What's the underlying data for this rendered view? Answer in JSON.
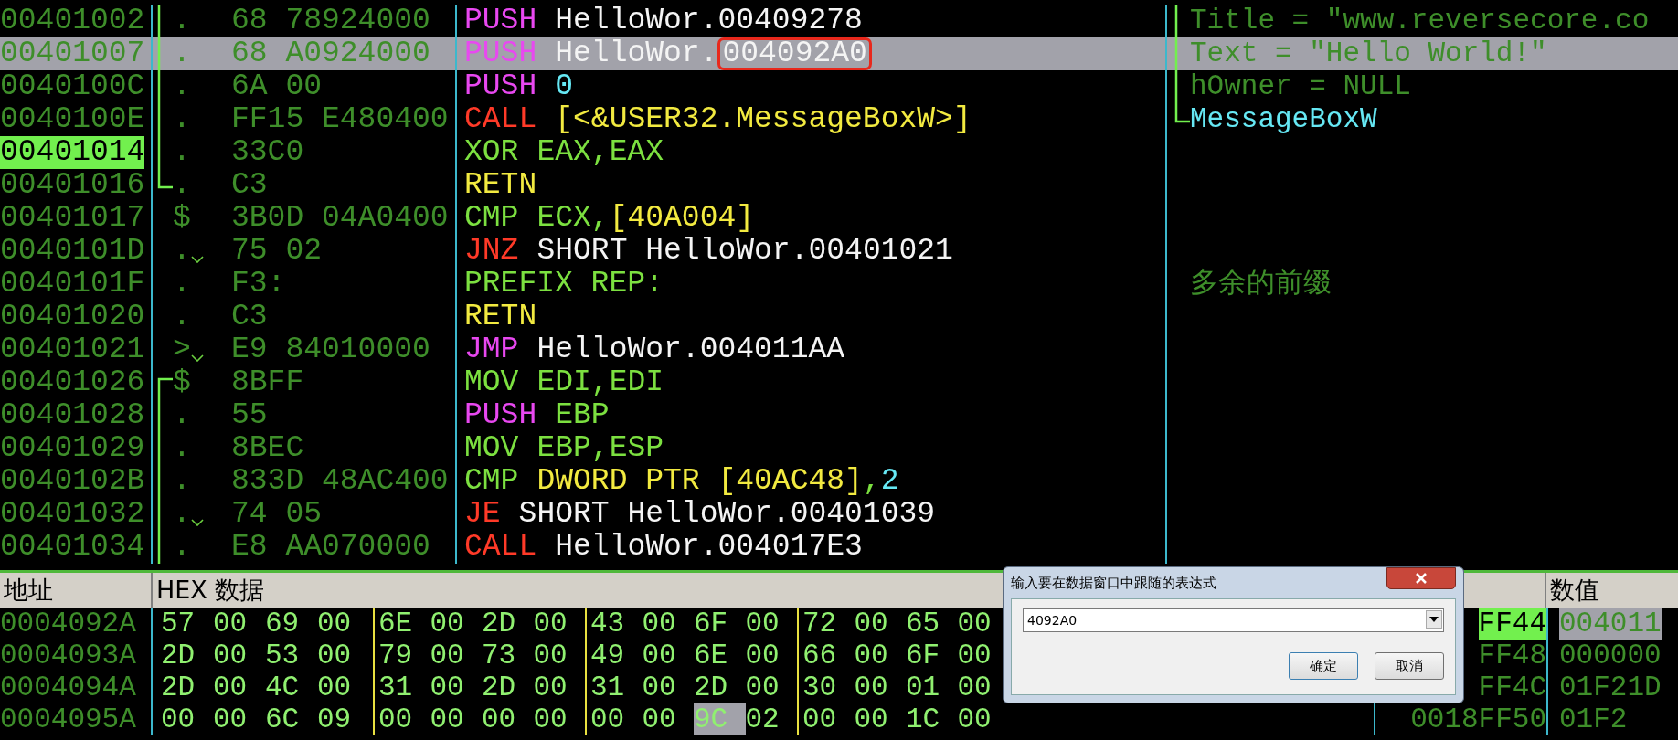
{
  "code_rows": [
    {
      "address": "00401002",
      "current": false,
      "selected": false,
      "bracket": {
        "kind": "mid"
      },
      "marker": ".",
      "jump_mark": false,
      "bytes": "68 78924000",
      "instruction": {
        "mnemonic": "PUSH",
        "kind": "push",
        "operands": [
          {
            "t": "HelloWor.00409278",
            "kind": "label"
          }
        ]
      },
      "comment": {
        "text": "Title = ″www.reversecore.co",
        "kind": "arg",
        "bracket": {
          "kind": "mid"
        }
      }
    },
    {
      "address": "00401007",
      "current": false,
      "selected": true,
      "bracket": {
        "kind": "mid"
      },
      "marker": ".",
      "jump_mark": false,
      "bytes": "68 A0924000",
      "instruction": {
        "mnemonic": "PUSH",
        "kind": "push",
        "operands": [
          {
            "t": "HelloWor.",
            "kind": "label"
          },
          {
            "t": "004092A0",
            "kind": "annotated"
          }
        ]
      },
      "comment": {
        "text": "Text = ″Hello World!″",
        "kind": "arg",
        "bracket": {
          "kind": "mid"
        }
      }
    },
    {
      "address": "0040100C",
      "current": false,
      "selected": false,
      "bracket": {
        "kind": "mid"
      },
      "marker": ".",
      "jump_mark": false,
      "bytes": "6A 00",
      "instruction": {
        "mnemonic": "PUSH",
        "kind": "push",
        "operands": [
          {
            "t": "0",
            "kind": "const"
          }
        ]
      },
      "comment": {
        "text": "hOwner = NULL",
        "kind": "arg",
        "bracket": {
          "kind": "mid"
        }
      }
    },
    {
      "address": "0040100E",
      "current": false,
      "selected": false,
      "bracket": {
        "kind": "mid"
      },
      "marker": ".",
      "jump_mark": false,
      "bytes": "FF15 E480400",
      "instruction": {
        "mnemonic": "CALL",
        "kind": "call",
        "operands": [
          {
            "t": "[<&USER32.MessageBoxW>]",
            "kind": "mem"
          }
        ]
      },
      "comment": {
        "text": "MessageBoxW",
        "kind": "api",
        "bracket": {
          "kind": "end"
        }
      }
    },
    {
      "address": "00401014",
      "current": true,
      "selected": false,
      "bracket": {
        "kind": "mid"
      },
      "marker": ".",
      "jump_mark": false,
      "bytes": "33C0",
      "instruction": {
        "mnemonic": "XOR",
        "kind": "plain",
        "operands": [
          {
            "t": "EAX,EAX",
            "kind": "reg"
          }
        ]
      }
    },
    {
      "address": "00401016",
      "current": false,
      "selected": false,
      "bracket": {
        "kind": "end"
      },
      "marker": ".",
      "jump_mark": false,
      "bytes": "C3",
      "instruction": {
        "mnemonic": "RETN",
        "kind": "ret"
      }
    },
    {
      "address": "00401017",
      "current": false,
      "selected": false,
      "marker": "$",
      "jump_mark": false,
      "bytes": "3B0D 04A0400",
      "instruction": {
        "mnemonic": "CMP",
        "kind": "plain",
        "operands": [
          {
            "t": "ECX,",
            "kind": "reg"
          },
          {
            "t": "[40A004]",
            "kind": "mem"
          }
        ]
      }
    },
    {
      "address": "0040101D",
      "current": false,
      "selected": false,
      "marker": ".",
      "jump_mark": true,
      "bytes": "75 02",
      "instruction": {
        "mnemonic": "JNZ",
        "kind": "jcc",
        "operands": [
          {
            "t": "SHORT HelloWor.00401021",
            "kind": "label"
          }
        ]
      }
    },
    {
      "address": "0040101F",
      "current": false,
      "selected": false,
      "marker": ".",
      "jump_mark": false,
      "bytes": "F3:",
      "instruction": {
        "mnemonic": "PREFIX REP:",
        "kind": "plain"
      },
      "comment": {
        "text": "多余的前缀",
        "kind": "arg"
      }
    },
    {
      "address": "00401020",
      "current": false,
      "selected": false,
      "marker": ".",
      "jump_mark": false,
      "bytes": "C3",
      "instruction": {
        "mnemonic": "RETN",
        "kind": "ret"
      }
    },
    {
      "address": "00401021",
      "current": false,
      "selected": false,
      "marker": ">",
      "jump_mark": true,
      "bytes": "E9 84010000",
      "instruction": {
        "mnemonic": "JMP",
        "kind": "push",
        "operands": [
          {
            "t": "HelloWor.004011AA",
            "kind": "label"
          }
        ]
      }
    },
    {
      "address": "00401026",
      "current": false,
      "selected": false,
      "bracket": {
        "kind": "start"
      },
      "marker": "$",
      "jump_mark": false,
      "bytes": "8BFF",
      "instruction": {
        "mnemonic": "MOV",
        "kind": "plain",
        "operands": [
          {
            "t": "EDI,EDI",
            "kind": "reg"
          }
        ]
      }
    },
    {
      "address": "00401028",
      "current": false,
      "selected": false,
      "bracket": {
        "kind": "mid"
      },
      "marker": ".",
      "jump_mark": false,
      "bytes": "55",
      "instruction": {
        "mnemonic": "PUSH",
        "kind": "push",
        "operands": [
          {
            "t": "EBP",
            "kind": "reg"
          }
        ]
      }
    },
    {
      "address": "00401029",
      "current": false,
      "selected": false,
      "bracket": {
        "kind": "mid"
      },
      "marker": ".",
      "jump_mark": false,
      "bytes": "8BEC",
      "instruction": {
        "mnemonic": "MOV",
        "kind": "plain",
        "operands": [
          {
            "t": "EBP,ESP",
            "kind": "reg"
          }
        ]
      }
    },
    {
      "address": "0040102B",
      "current": false,
      "selected": false,
      "bracket": {
        "kind": "mid"
      },
      "marker": ".",
      "jump_mark": false,
      "bytes": "833D 48AC400",
      "instruction": {
        "mnemonic": "CMP",
        "kind": "plain",
        "operands": [
          {
            "t": "DWORD PTR [40AC48]",
            "kind": "mem"
          },
          {
            "t": ",",
            "kind": "reg"
          },
          {
            "t": "2",
            "kind": "const"
          }
        ]
      }
    },
    {
      "address": "00401032",
      "current": false,
      "selected": false,
      "bracket": {
        "kind": "mid"
      },
      "marker": ".",
      "jump_mark": true,
      "bytes": "74 05",
      "instruction": {
        "mnemonic": "JE",
        "kind": "jcc",
        "operands": [
          {
            "t": "SHORT HelloWor.00401039",
            "kind": "label"
          }
        ]
      }
    },
    {
      "address": "00401034",
      "current": false,
      "selected": false,
      "bracket": {
        "kind": "mid"
      },
      "marker": ".",
      "jump_mark": false,
      "bytes": "E8 AA070000",
      "instruction": {
        "mnemonic": "CALL",
        "kind": "call",
        "operands": [
          {
            "t": "HelloWor.004017E3",
            "kind": "label"
          }
        ]
      }
    }
  ],
  "dump": {
    "headers": {
      "address": "地址",
      "hex": "HEX 数据",
      "value": "数值"
    },
    "rows": [
      {
        "address": "0004092A",
        "bytes": [
          {
            "v": "57",
            "selected": false
          },
          {
            "v": "00",
            "selected": false
          },
          {
            "v": "69",
            "selected": false
          },
          {
            "v": "00",
            "selected": false
          },
          {
            "v": "6E",
            "selected": false
          },
          {
            "v": "00",
            "selected": false
          },
          {
            "v": "2D",
            "selected": false
          },
          {
            "v": "00",
            "selected": false
          },
          {
            "v": "43",
            "selected": false
          },
          {
            "v": "00",
            "selected": false
          },
          {
            "v": "6F",
            "selected": false
          },
          {
            "v": "00",
            "selected": false
          },
          {
            "v": "72",
            "selected": false
          },
          {
            "v": "00",
            "selected": false
          },
          {
            "v": "65",
            "selected": false
          },
          {
            "v": "00",
            "selected": false
          }
        ],
        "stack_address": "FF44",
        "stack_value": "004011",
        "selected": true
      },
      {
        "address": "0004093A",
        "bytes": [
          {
            "v": "2D",
            "selected": false
          },
          {
            "v": "00",
            "selected": false
          },
          {
            "v": "53",
            "selected": false
          },
          {
            "v": "00",
            "selected": false
          },
          {
            "v": "79",
            "selected": false
          },
          {
            "v": "00",
            "selected": false
          },
          {
            "v": "73",
            "selected": false
          },
          {
            "v": "00",
            "selected": false
          },
          {
            "v": "49",
            "selected": false
          },
          {
            "v": "00",
            "selected": false
          },
          {
            "v": "6E",
            "selected": false
          },
          {
            "v": "00",
            "selected": false
          },
          {
            "v": "66",
            "selected": false
          },
          {
            "v": "00",
            "selected": false
          },
          {
            "v": "6F",
            "selected": false
          },
          {
            "v": "00",
            "selected": false
          }
        ],
        "stack_address": "FF48",
        "stack_value": "000000",
        "selected": false
      },
      {
        "address": "0004094A",
        "bytes": [
          {
            "v": "2D",
            "selected": false
          },
          {
            "v": "00",
            "selected": false
          },
          {
            "v": "4C",
            "selected": false
          },
          {
            "v": "00",
            "selected": false
          },
          {
            "v": "31",
            "selected": false
          },
          {
            "v": "00",
            "selected": false
          },
          {
            "v": "2D",
            "selected": false
          },
          {
            "v": "00",
            "selected": false
          },
          {
            "v": "31",
            "selected": false
          },
          {
            "v": "00",
            "selected": false
          },
          {
            "v": "2D",
            "selected": false
          },
          {
            "v": "00",
            "selected": false
          },
          {
            "v": "30",
            "selected": false
          },
          {
            "v": "00",
            "selected": false
          },
          {
            "v": "01",
            "selected": false
          },
          {
            "v": "00",
            "selected": false
          }
        ],
        "stack_address": "FF4C",
        "stack_value": "01F21D",
        "selected": false
      },
      {
        "address": "0004095A",
        "bytes": [
          {
            "v": "00",
            "selected": false
          },
          {
            "v": "00",
            "selected": false
          },
          {
            "v": "6C",
            "selected": false
          },
          {
            "v": "09",
            "selected": false
          },
          {
            "v": "00",
            "selected": false
          },
          {
            "v": "00",
            "selected": false
          },
          {
            "v": "00",
            "selected": false
          },
          {
            "v": "00",
            "selected": false
          },
          {
            "v": "00",
            "selected": false
          },
          {
            "v": "00",
            "selected": false
          },
          {
            "v": "9C",
            "selected": true
          },
          {
            "v": "02",
            "selected": false
          },
          {
            "v": "00",
            "selected": false
          },
          {
            "v": "00",
            "selected": false
          },
          {
            "v": "1C",
            "selected": false
          },
          {
            "v": "00",
            "selected": false
          }
        ],
        "stack_address": "0018FF50",
        "stack_value": "01F2",
        "selected": false
      }
    ]
  },
  "dialog": {
    "title": "输入要在数据窗口中跟随的表达式",
    "value": "4092A0",
    "buttons": [
      "确定",
      "取消"
    ]
  }
}
